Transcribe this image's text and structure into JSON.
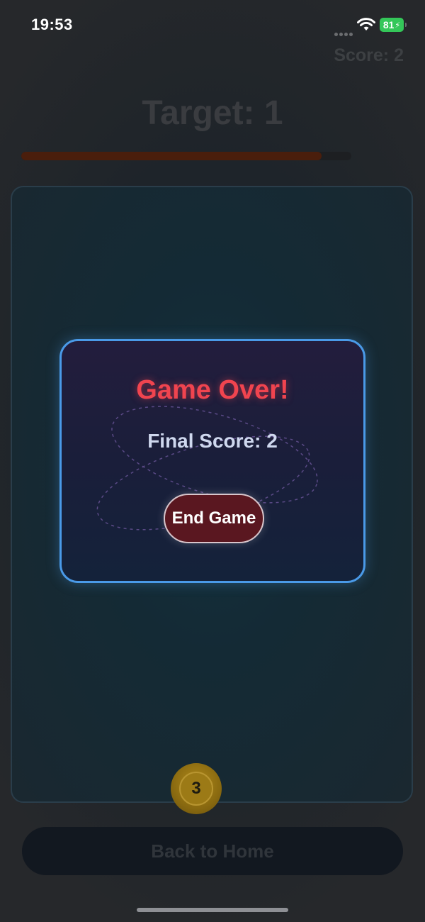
{
  "status_bar": {
    "time": "19:53",
    "battery_level": "81",
    "battery_color": "#34c759",
    "icons": [
      "signal-dots-icon",
      "wifi-icon",
      "battery-icon"
    ]
  },
  "game": {
    "score_label": "Score: 2",
    "target_label": "Target: 1",
    "timer_progress": 0.91,
    "ball_number": "3",
    "back_label": "Back to Home"
  },
  "modal": {
    "title": "Game Over!",
    "final_score": "Final Score: 2",
    "end_button_label": "End Game",
    "title_color": "#f0444f",
    "border_color": "#4a9ae8"
  }
}
